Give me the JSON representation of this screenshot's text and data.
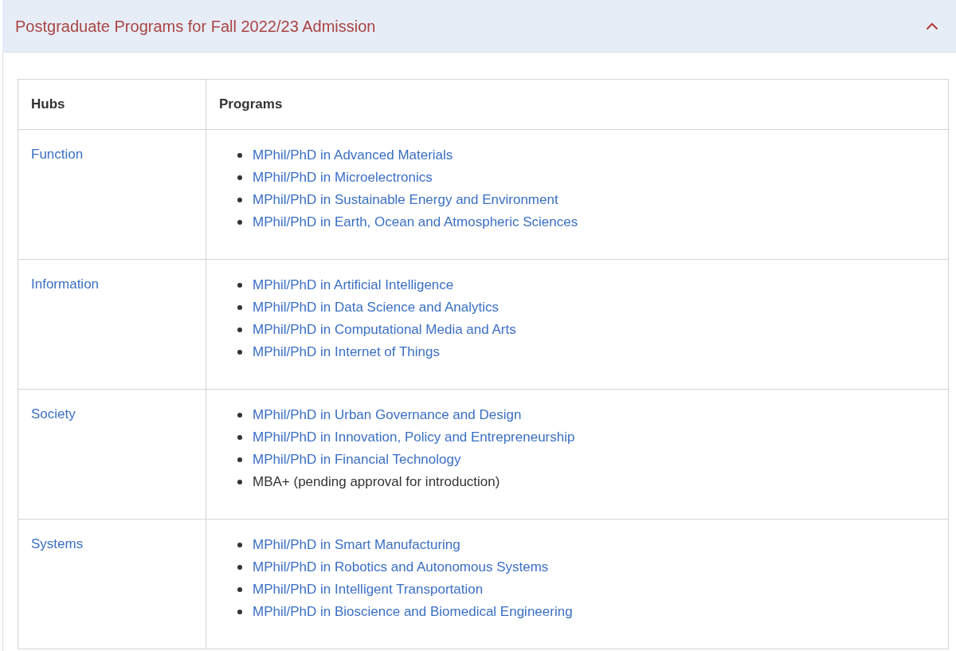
{
  "accordion": {
    "title": "Postgraduate Programs for Fall 2022/23 Admission",
    "expanded": true
  },
  "table": {
    "columns": [
      "Hubs",
      "Programs"
    ],
    "rows": [
      {
        "hub": "Function",
        "programs": [
          {
            "kind": "link",
            "text": "MPhil/PhD in Advanced Materials"
          },
          {
            "kind": "link",
            "text": "MPhil/PhD in Microelectronics"
          },
          {
            "kind": "link",
            "text": "MPhil/PhD in Sustainable Energy and Environment"
          },
          {
            "kind": "link",
            "text": "MPhil/PhD in Earth, Ocean and Atmospheric Sciences"
          }
        ]
      },
      {
        "hub": "Information",
        "programs": [
          {
            "kind": "link",
            "text": "MPhil/PhD in Artificial Intelligence"
          },
          {
            "kind": "link",
            "text": "MPhil/PhD in Data Science and Analytics"
          },
          {
            "kind": "link",
            "text": "MPhil/PhD in Computational Media and Arts"
          },
          {
            "kind": "link",
            "text": "MPhil/PhD in Internet of Things"
          }
        ]
      },
      {
        "hub": "Society",
        "programs": [
          {
            "kind": "link",
            "text": "MPhil/PhD in Urban Governance and Design"
          },
          {
            "kind": "link",
            "text": "MPhil/PhD in Innovation, Policy and Entrepreneurship"
          },
          {
            "kind": "link",
            "text": "MPhil/PhD in Financial Technology"
          },
          {
            "kind": "text",
            "text": "MBA+ (pending approval for introduction)"
          }
        ]
      },
      {
        "hub": "Systems",
        "programs": [
          {
            "kind": "link",
            "text": "MPhil/PhD in Smart Manufacturing"
          },
          {
            "kind": "link",
            "text": "MPhil/PhD in Robotics and Autonomous Systems"
          },
          {
            "kind": "link",
            "text": "MPhil/PhD in Intelligent Transportation"
          },
          {
            "kind": "link",
            "text": "MPhil/PhD in Bioscience and Biomedical Engineering"
          }
        ]
      }
    ]
  }
}
